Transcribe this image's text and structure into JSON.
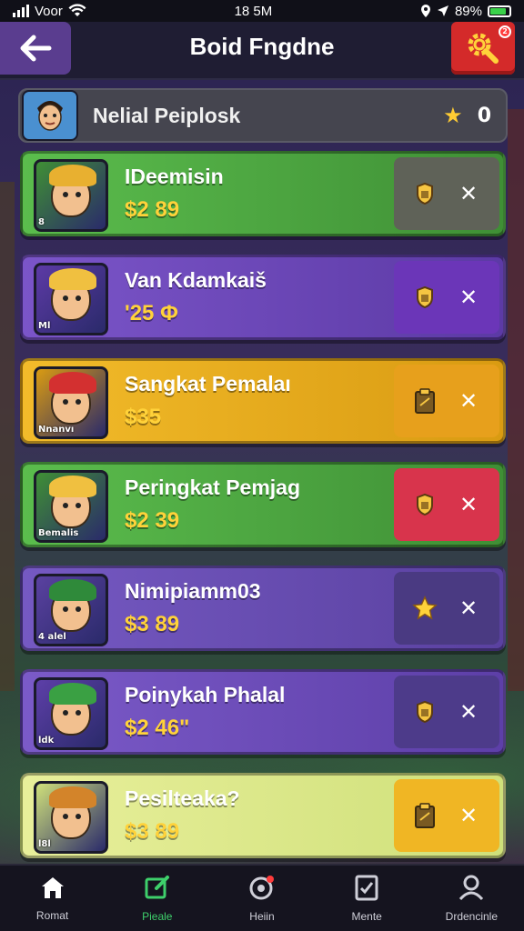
{
  "status_bar": {
    "carrier": "Voor",
    "time": "18 5M",
    "battery": "89%"
  },
  "header": {
    "title": "Boid Fngdne",
    "notification_badge": "2"
  },
  "summary": {
    "label": "Nelial Peiplosk",
    "count": "0"
  },
  "items": [
    {
      "name": "IDeemisin",
      "price": "$2 89",
      "tag": "8",
      "bg": "#5bbd4d",
      "bg2": "#3f8f35",
      "action_bg": "#5f6258",
      "hair": "#e8b030",
      "icon": "shield-icon"
    },
    {
      "name": "Van Kdamkaiš",
      "price": "'25 Φ",
      "tag": "Ml",
      "bg": "#7b55c9",
      "bg2": "#5c3aa5",
      "action_bg": "#6b36b8",
      "hair": "#f0c040",
      "icon": "shield-icon"
    },
    {
      "name": "Sangkat Pemalaı",
      "price": "$35",
      "tag": "Nnanvı",
      "bg": "#f2bb2a",
      "bg2": "#d99b12",
      "action_bg": "#e7a01c",
      "hair": "#d33030",
      "icon": "clipboard-icon"
    },
    {
      "name": "Peringkat Pemjag",
      "price": "$2 39",
      "tag": "Bemalis",
      "bg": "#5bbd4d",
      "bg2": "#3f8f35",
      "action_bg": "#d8344c",
      "hair": "#f0c040",
      "icon": "shield-icon"
    },
    {
      "name": "Nimipiamm03",
      "price": "$3 89",
      "tag": "4 alel",
      "bg": "#7559c2",
      "bg2": "#5a41a0",
      "action_bg": "#4a3a82",
      "hair": "#2f8a3a",
      "icon": "star-icon"
    },
    {
      "name": "Poinykah Phalal",
      "price": "$2 46\"",
      "tag": "ldk",
      "bg": "#7b5ac8",
      "bg2": "#5d3fa8",
      "action_bg": "#4d3b8a",
      "hair": "#3aa043",
      "icon": "shield-icon"
    },
    {
      "name": "Pesilteaka?",
      "price": "$3 89",
      "tag": "l8l",
      "bg": "#e8ef9a",
      "bg2": "#cfe07a",
      "action_bg": "#f0b624",
      "hair": "#d3842a",
      "icon": "clipboard-icon"
    }
  ],
  "x_label": "✕",
  "bottom_nav": [
    {
      "label": "Romat",
      "icon": "home-icon"
    },
    {
      "label": "Pieale",
      "icon": "edit-icon",
      "active": true
    },
    {
      "label": "Heiin",
      "icon": "target-icon"
    },
    {
      "label": "Mente",
      "icon": "checklist-icon"
    },
    {
      "label": "Drdencinle",
      "icon": "profile-icon"
    }
  ]
}
